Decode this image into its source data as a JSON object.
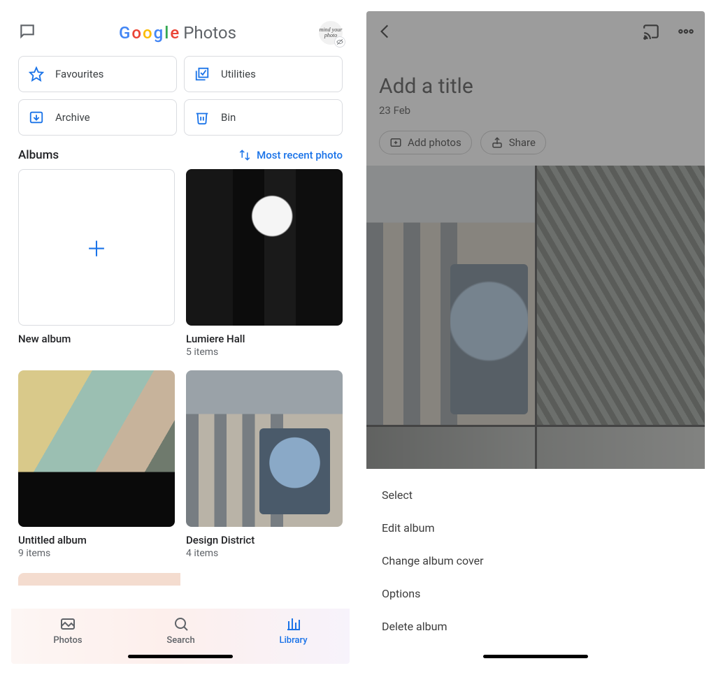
{
  "left": {
    "app_title_parts": [
      "G",
      "o",
      "o",
      "g",
      "l",
      "e"
    ],
    "app_title_photos": "Photos",
    "avatar_text": "mind your photo",
    "shortcuts": {
      "favourites": "Favourites",
      "utilities": "Utilities",
      "archive": "Archive",
      "bin": "Bin"
    },
    "albums_section": "Albums",
    "sort_label": "Most recent photo",
    "albums": {
      "new_album": "New album",
      "lumiere_title": "Lumiere Hall",
      "lumiere_sub": "5 items",
      "untitled_title": "Untitled album",
      "untitled_sub": "9 items",
      "design_title": "Design District",
      "design_sub": "4 items"
    },
    "nav": {
      "photos": "Photos",
      "search": "Search",
      "library": "Library"
    }
  },
  "right": {
    "title_placeholder": "Add a title",
    "date": "23 Feb",
    "chip_add": "Add photos",
    "chip_share": "Share",
    "menu": {
      "select": "Select",
      "edit": "Edit album",
      "cover": "Change album cover",
      "options": "Options",
      "delete": "Delete album"
    }
  }
}
